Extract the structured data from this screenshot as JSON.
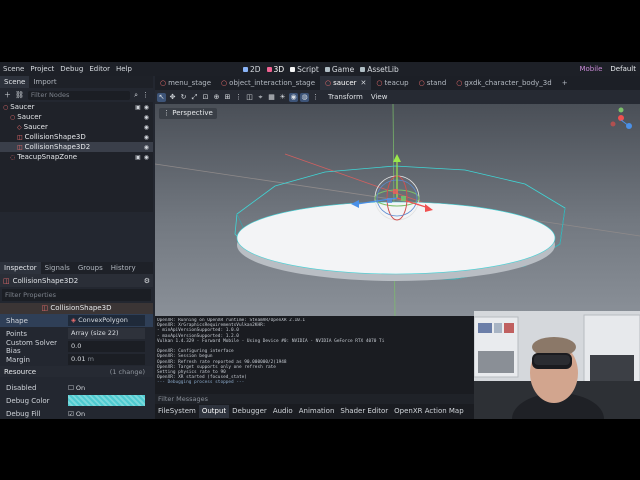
{
  "menubar": {
    "items": [
      "Scene",
      "Project",
      "Debug",
      "Editor",
      "Help"
    ],
    "workspaces": [
      {
        "label": "2D",
        "color": "#8ab4f8"
      },
      {
        "label": "3D",
        "color": "#f06292"
      },
      {
        "label": "Script",
        "color": "#f5f5f5"
      },
      {
        "label": "Game",
        "color": "#b0bec5"
      },
      {
        "label": "AssetLib",
        "color": "#b0bec5"
      }
    ],
    "renderer": "Mobile",
    "layout": "Default"
  },
  "left_dock": {
    "tabs": [
      "Scene",
      "Import"
    ],
    "filter_placeholder": "Filter Nodes",
    "tree": [
      {
        "label": "Saucer",
        "icon": "node3d-icon",
        "color": "#ef6f6f",
        "indent": 0
      },
      {
        "label": "Saucer",
        "icon": "node3d-icon",
        "color": "#ef6f6f",
        "indent": 1
      },
      {
        "label": "Saucer",
        "icon": "mesh-icon",
        "color": "#ef6f6f",
        "indent": 2
      },
      {
        "label": "CollisionShape3D",
        "icon": "collision-shape-icon",
        "color": "#ef6f6f",
        "indent": 2
      },
      {
        "label": "CollisionShape3D2",
        "icon": "collision-shape-icon",
        "color": "#ef6f6f",
        "indent": 2
      },
      {
        "label": "TeacupSnapZone",
        "icon": "area-icon",
        "color": "#ef6f6f",
        "indent": 1
      }
    ]
  },
  "inspector": {
    "tabs": [
      "Inspector",
      "Signals",
      "Groups",
      "History"
    ],
    "node_name": "CollisionShape3D2",
    "filter_placeholder": "Filter Properties",
    "section": "CollisionShape3D",
    "props": [
      {
        "label": "Shape",
        "value": "ConvexPolygon"
      },
      {
        "label": "Points",
        "value": "Array (size 22)"
      },
      {
        "label": "Custom Solver Bias",
        "value": "0.0"
      },
      {
        "label": "Margin",
        "value": "0.01",
        "unit": "m"
      }
    ],
    "resource_label": "Resource",
    "resource_changes": "(1 change)",
    "extra": [
      {
        "label": "Disabled",
        "value": "On"
      },
      {
        "label": "Debug Color",
        "value": ""
      },
      {
        "label": "Debug Fill",
        "value": "On"
      }
    ]
  },
  "scene_tabs": [
    "menu_stage",
    "object_interaction_stage",
    "saucer",
    "teacup",
    "stand",
    "gxdk_character_body_3d"
  ],
  "active_scene_tab": "saucer",
  "viewport": {
    "menus": [
      "Transform",
      "View"
    ],
    "perspective_label": "Perspective"
  },
  "console_lines": [
    "OpenXR: Running on OpenXR runtime:  SteamVR/OpenXR   2.10.1",
    "OpenXR: XrGraphicsRequirementsVulkan2KHR:",
    " - minApiVersionSupported:  1.0.0",
    " - maxApiVersionSupported:  1.2.0",
    "Vulkan 1.4.329 - Forward Mobile - Using Device #0: NVIDIA - NVIDIA GeForce RTX 4070 Ti",
    "",
    "OpenXR: Configuring interface",
    "OpenXR: Session begun",
    "OpenXR: Refresh rate reported as 90.000000/2(1948",
    "OpenXR: Target supports only one refresh rate",
    "Setting physics rate to 90",
    "OpenXR: XR started (focused_state)",
    "--- Debugging process stopped ---"
  ],
  "bottom": {
    "filter_placeholder": "Filter Messages",
    "tabs": [
      "FileSystem",
      "Output",
      "Debugger",
      "Audio",
      "Animation",
      "Shader Editor",
      "OpenXR Action Map"
    ],
    "active_tab": "Output"
  }
}
